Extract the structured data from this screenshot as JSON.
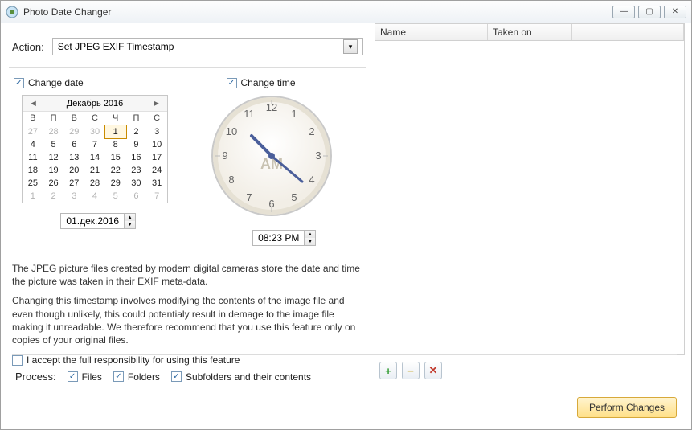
{
  "window": {
    "title": "Photo Date Changer"
  },
  "action": {
    "label": "Action:",
    "value": "Set JPEG EXIF Timestamp"
  },
  "change_date": {
    "label": "Change date"
  },
  "change_time": {
    "label": "Change time"
  },
  "calendar": {
    "month": "Декабрь 2016",
    "dow": [
      "В",
      "П",
      "В",
      "С",
      "Ч",
      "П",
      "С"
    ],
    "prev_tail": [
      "27",
      "28",
      "29",
      "30"
    ],
    "days": [
      "1",
      "2",
      "3",
      "4",
      "5",
      "6",
      "7",
      "8",
      "9",
      "10",
      "11",
      "12",
      "13",
      "14",
      "15",
      "16",
      "17",
      "18",
      "19",
      "20",
      "21",
      "22",
      "23",
      "24",
      "25",
      "26",
      "27",
      "28",
      "29",
      "30",
      "31"
    ],
    "next_head": [
      "1",
      "2",
      "3",
      "4",
      "5",
      "6",
      "7"
    ],
    "selected": "1"
  },
  "date_spinner": "01.дек.2016",
  "time_spinner": "08:23 PM",
  "clock": {
    "ampm": "AM"
  },
  "info": {
    "p1": "The JPEG picture files created by modern digital cameras store the date and time the picture was taken in their EXIF meta-data.",
    "p2": "Changing this timestamp involves modifying the contents of the image file and even though unlikely, this could potentialy result in demage to the image file making it unreadable. We therefore recommend that you use this feature only on copies of your original files.",
    "accept": "I accept the full responsibility for using this feature"
  },
  "process": {
    "label": "Process:",
    "files": "Files",
    "folders": "Folders",
    "subfolders": "Subfolders and their contents"
  },
  "table": {
    "col_name": "Name",
    "col_taken": "Taken on"
  },
  "buttons": {
    "perform": "Perform Changes"
  }
}
